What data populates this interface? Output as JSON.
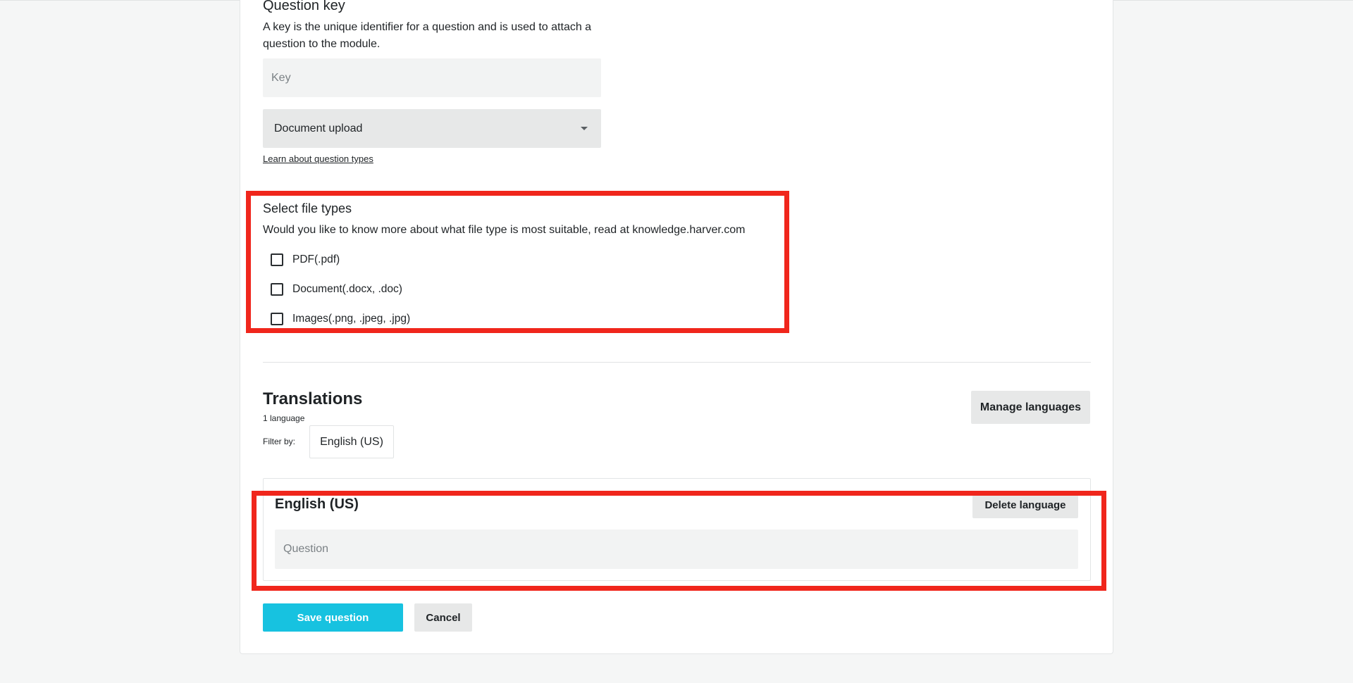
{
  "question_key": {
    "title": "Question key",
    "description": "A key is the unique identifier for a question and is used to attach a question to the module.",
    "key_placeholder": "Key",
    "key_value": ""
  },
  "question_type": {
    "selected": "Document upload",
    "learn_link": "Learn about question types"
  },
  "file_types": {
    "title": "Select file types",
    "description": "Would you like to know more about what file type is most suitable, read at knowledge.harver.com",
    "options": [
      {
        "label": "PDF(.pdf)",
        "checked": false
      },
      {
        "label": "Document(.docx, .doc)",
        "checked": false
      },
      {
        "label": "Images(.png, .jpeg, .jpg)",
        "checked": false
      }
    ]
  },
  "translations": {
    "title": "Translations",
    "count": "1 language",
    "filter_label": "Filter by:",
    "filter_value": "English (US)",
    "manage_button": "Manage languages",
    "language": {
      "title": "English (US)",
      "delete_button": "Delete language",
      "question_placeholder": "Question",
      "question_value": ""
    }
  },
  "actions": {
    "save": "Save question",
    "cancel": "Cancel"
  },
  "colors": {
    "primary": "#17c2e0",
    "highlight": "#f0261c",
    "background": "#f5f6f6",
    "input_bg": "#f2f3f3"
  }
}
